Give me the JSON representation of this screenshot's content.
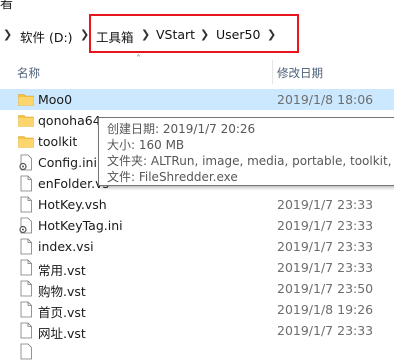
{
  "window": {
    "title_fragment": "看"
  },
  "breadcrumb": {
    "items": [
      "软件 (D:)",
      "工具箱",
      "VStart",
      "User50"
    ]
  },
  "columns": {
    "name": "名称",
    "date_modified": "修改日期"
  },
  "files": [
    {
      "name": "Moo0",
      "date": "2019/1/8 18:06",
      "type": "folder"
    },
    {
      "name": "qonoha64",
      "date": "",
      "type": "folder"
    },
    {
      "name": "toolkit",
      "date": "",
      "type": "folder"
    },
    {
      "name": "Config.ini",
      "date": "",
      "type": "ini"
    },
    {
      "name": "enFolder.vs",
      "date": "",
      "type": "file"
    },
    {
      "name": "HotKey.vsh",
      "date": "2019/1/7 23:33",
      "type": "file"
    },
    {
      "name": "HotKeyTag.ini",
      "date": "2019/1/7 23:33",
      "type": "ini"
    },
    {
      "name": "index.vsi",
      "date": "2019/1/7 23:33",
      "type": "file"
    },
    {
      "name": "常用.vst",
      "date": "2019/1/7 23:33",
      "type": "file"
    },
    {
      "name": "购物.vst",
      "date": "2019/1/7 23:50",
      "type": "file"
    },
    {
      "name": "首页.vst",
      "date": "2019/1/8 19:26",
      "type": "file"
    },
    {
      "name": "网址.vst",
      "date": "2019/1/7 23:33",
      "type": "file"
    }
  ],
  "tooltip": {
    "created": "创建日期: 2019/1/7 20:26",
    "size": "大小: 160 MB",
    "folders": "文件夹: ALTRun, image, media, portable, toolkit, U",
    "files": "文件: FileShredder.exe"
  },
  "colors": {
    "selection": "#cce8ff",
    "highlight_box": "#e8141e",
    "folder": "#f5c342"
  }
}
